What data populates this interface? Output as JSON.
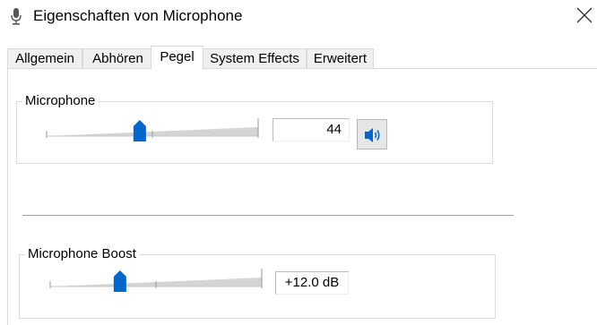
{
  "window": {
    "title": "Eigenschaften von Microphone",
    "close_icon": "close-icon"
  },
  "tabs": [
    {
      "label": "Allgemein",
      "active": false
    },
    {
      "label": "Abhören",
      "active": false
    },
    {
      "label": "Pegel",
      "active": true
    },
    {
      "label": "System Effects",
      "active": false
    },
    {
      "label": "Erweitert",
      "active": false
    }
  ],
  "microphone": {
    "group_label": "Microphone",
    "level_value": "44",
    "slider_fraction": 0.44,
    "mute_button_icon": "speaker-volume-icon"
  },
  "boost": {
    "group_label": "Microphone Boost",
    "value": "+12.0 dB",
    "slider_fraction": 0.33
  },
  "colors": {
    "accent": "#0066cc",
    "track": "#d4d4d4"
  }
}
